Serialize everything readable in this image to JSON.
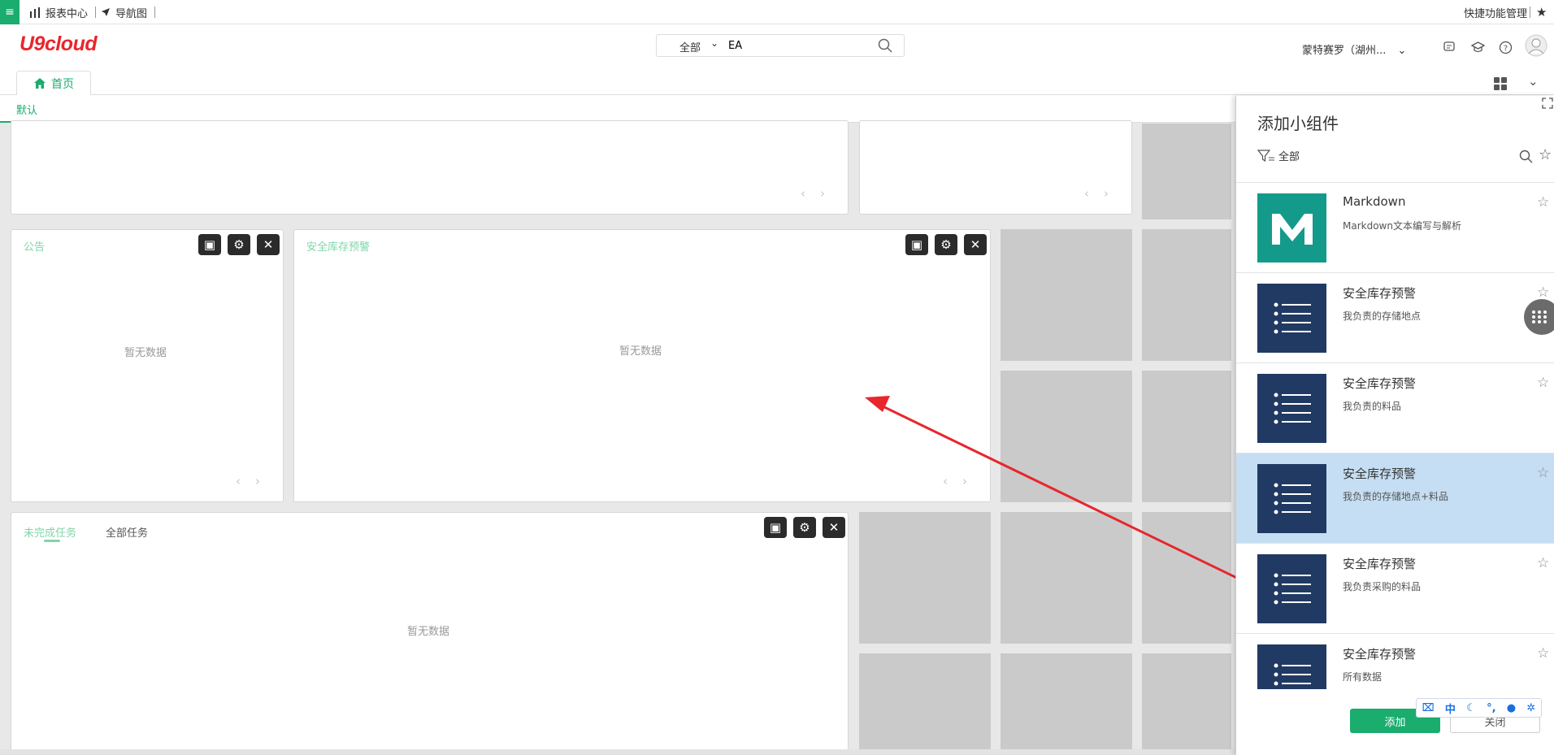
{
  "topbar": {
    "menu_icon": "hamburger-icon",
    "report_center": "报表中心",
    "nav_map": "导航图",
    "quick_manage": "快捷功能管理"
  },
  "header": {
    "logo": "U9cloud",
    "search_scope": "全部",
    "search_value": "EA",
    "org_name": "蒙特赛罗（湖州..."
  },
  "tabs": {
    "home": "首页",
    "default_sub": "默认"
  },
  "cards": {
    "notice_title": "公告",
    "safety_title": "安全库存预警",
    "task_tab_open": "未完成任务",
    "task_tab_all": "全部任务",
    "empty_text": "暂无数据"
  },
  "panel": {
    "title": "添加小组件",
    "filter_label": "全部",
    "items": [
      {
        "name": "Markdown",
        "desc": "Markdown文本编写与解析"
      },
      {
        "name": "安全库存预警",
        "desc": "我负责的存储地点"
      },
      {
        "name": "安全库存预警",
        "desc": "我负责的料品"
      },
      {
        "name": "安全库存预警",
        "desc": "我负责的存储地点+料品"
      },
      {
        "name": "安全库存预警",
        "desc": "我负责采购的料品"
      },
      {
        "name": "安全库存预警",
        "desc": "所有数据"
      }
    ],
    "add_button": "添加",
    "close_button": "关闭"
  },
  "ime": {
    "lang": "中"
  },
  "colors": {
    "brand_green": "#1aad6e",
    "logo_red": "#e8262c",
    "thumb_navy": "#213a63",
    "thumb_teal": "#139a8a",
    "selected_row": "#c5def3",
    "annotation_arrow": "#e8262c"
  }
}
